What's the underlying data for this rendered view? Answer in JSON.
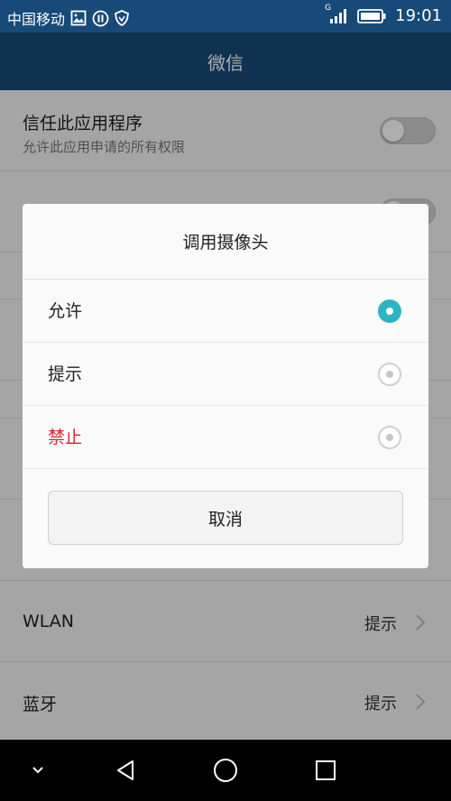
{
  "status_bar": {
    "carrier": "中国移动",
    "network_type": "G",
    "time": "19:01",
    "left_icons": [
      "gallery-icon",
      "pause-circle-icon",
      "shield-icon"
    ],
    "right_icons": [
      "signal-icon",
      "battery-icon"
    ]
  },
  "title_bar": {
    "title": "微信"
  },
  "settings": {
    "trust_row": {
      "title": "信任此应用程序",
      "subtitle": "允许此应用申请的所有权限"
    },
    "wlan_row": {
      "title": "WLAN",
      "value": "提示"
    },
    "bluetooth_row": {
      "title": "蓝牙",
      "value": "提示"
    }
  },
  "dialog": {
    "title": "调用摄像头",
    "options": [
      {
        "label": "允许",
        "selected": true,
        "color": "#222222"
      },
      {
        "label": "提示",
        "selected": false,
        "color": "#222222"
      },
      {
        "label": "禁止",
        "selected": false,
        "color": "#d42a2a"
      }
    ],
    "cancel_label": "取消"
  },
  "colors": {
    "primary": "#174a78",
    "accent": "#2cb5c0",
    "danger": "#d42a2a"
  },
  "nav_bar": {
    "icons": [
      "chevron-down-icon",
      "back-icon",
      "home-icon",
      "recents-icon"
    ]
  }
}
